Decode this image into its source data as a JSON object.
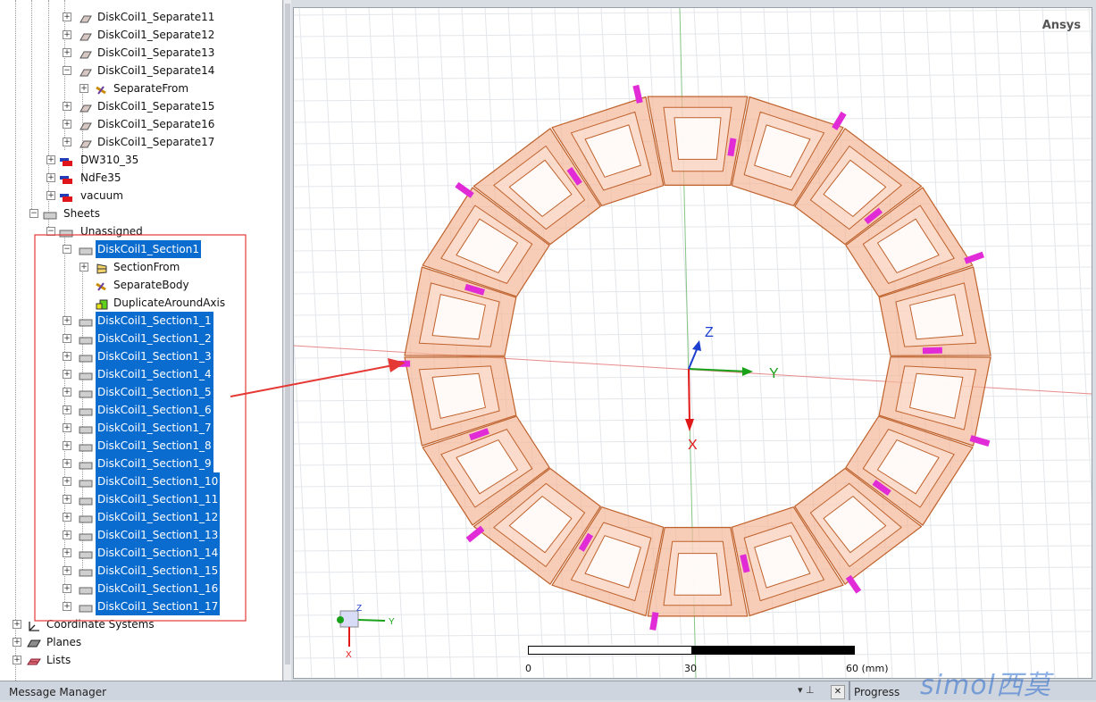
{
  "tree": {
    "rows": [
      {
        "label": "DiskCoil1_Separate11",
        "icon": "solid-object-icon"
      },
      {
        "label": "DiskCoil1_Separate12",
        "icon": "solid-object-icon"
      },
      {
        "label": "DiskCoil1_Separate13",
        "icon": "solid-object-icon"
      },
      {
        "label": "DiskCoil1_Separate14",
        "icon": "solid-object-icon"
      },
      {
        "label": "SeparateFrom",
        "icon": "separate-operation-icon"
      },
      {
        "label": "DiskCoil1_Separate15",
        "icon": "solid-object-icon"
      },
      {
        "label": "DiskCoil1_Separate16",
        "icon": "solid-object-icon"
      },
      {
        "label": "DiskCoil1_Separate17",
        "icon": "solid-object-icon"
      },
      {
        "label": "DW310_35",
        "icon": "material-icon"
      },
      {
        "label": "NdFe35",
        "icon": "material-icon"
      },
      {
        "label": "vacuum",
        "icon": "material-icon"
      },
      {
        "label": "Sheets",
        "icon": "sheet-icon"
      },
      {
        "label": "Unassigned",
        "icon": "sheet-icon"
      },
      {
        "label": "DiskCoil1_Section1",
        "icon": "sheet-icon"
      },
      {
        "label": "SectionFrom",
        "icon": "section-operation-icon"
      },
      {
        "label": "SeparateBody",
        "icon": "separate-operation-icon"
      },
      {
        "label": "DuplicateAroundAxis",
        "icon": "duplicate-operation-icon"
      },
      {
        "label": "DiskCoil1_Section1_1",
        "icon": "sheet-icon"
      },
      {
        "label": "DiskCoil1_Section1_2",
        "icon": "sheet-icon"
      },
      {
        "label": "DiskCoil1_Section1_3",
        "icon": "sheet-icon"
      },
      {
        "label": "DiskCoil1_Section1_4",
        "icon": "sheet-icon"
      },
      {
        "label": "DiskCoil1_Section1_5",
        "icon": "sheet-icon"
      },
      {
        "label": "DiskCoil1_Section1_6",
        "icon": "sheet-icon"
      },
      {
        "label": "DiskCoil1_Section1_7",
        "icon": "sheet-icon"
      },
      {
        "label": "DiskCoil1_Section1_8",
        "icon": "sheet-icon"
      },
      {
        "label": "DiskCoil1_Section1_9",
        "icon": "sheet-icon"
      },
      {
        "label": "DiskCoil1_Section1_10",
        "icon": "sheet-icon"
      },
      {
        "label": "DiskCoil1_Section1_11",
        "icon": "sheet-icon"
      },
      {
        "label": "DiskCoil1_Section1_12",
        "icon": "sheet-icon"
      },
      {
        "label": "DiskCoil1_Section1_13",
        "icon": "sheet-icon"
      },
      {
        "label": "DiskCoil1_Section1_14",
        "icon": "sheet-icon"
      },
      {
        "label": "DiskCoil1_Section1_15",
        "icon": "sheet-icon"
      },
      {
        "label": "DiskCoil1_Section1_16",
        "icon": "sheet-icon"
      },
      {
        "label": "DiskCoil1_Section1_17",
        "icon": "sheet-icon"
      },
      {
        "label": "Coordinate Systems",
        "icon": "coordinate-system-icon"
      },
      {
        "label": "Planes",
        "icon": "plane-icon"
      },
      {
        "label": "Lists",
        "icon": "list-icon"
      }
    ]
  },
  "viewport": {
    "brand": "Ansys",
    "axis_x": "X",
    "axis_y": "Y",
    "axis_z": "Z",
    "scale": {
      "tick0": "0",
      "tick1": "30",
      "tick2": "60 (mm)"
    },
    "coil_count": 18
  },
  "colors": {
    "selection": "#0a6cce",
    "coil_fill": "#f4b89a",
    "coil_edge": "#c0622c",
    "section_face": "#e02bd6",
    "annotation": "#e53935"
  },
  "bottom": {
    "message_manager": "Message Manager",
    "progress": "Progress",
    "pin_glyph": "▾ ⊥",
    "close_glyph": "✕"
  },
  "watermark": "simol西莫"
}
